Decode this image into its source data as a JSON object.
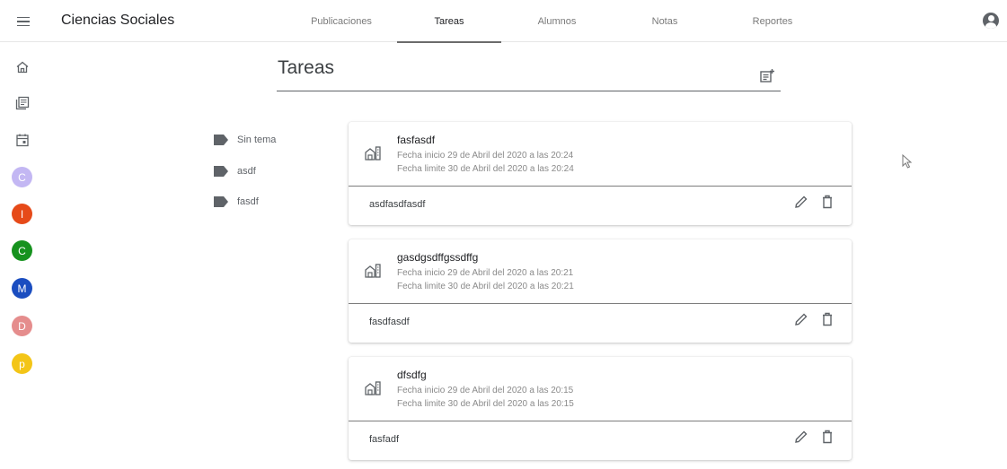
{
  "header": {
    "title": "Ciencias Sociales",
    "tabs": [
      {
        "label": "Publicaciones",
        "active": false
      },
      {
        "label": "Tareas",
        "active": true
      },
      {
        "label": "Alumnos",
        "active": false
      },
      {
        "label": "Notas",
        "active": false
      },
      {
        "label": "Reportes",
        "active": false
      }
    ],
    "account_icon": "account-circle-icon"
  },
  "rail": {
    "icons": [
      "home-icon",
      "class-list-icon",
      "calendar-icon"
    ],
    "avatars": [
      {
        "letter": "C",
        "color": "#c3b7f3"
      },
      {
        "letter": "I",
        "color": "#e64a19"
      },
      {
        "letter": "C",
        "color": "#16921e"
      },
      {
        "letter": "M",
        "color": "#1a4dc0"
      },
      {
        "letter": "D",
        "color": "#e58d8d"
      },
      {
        "letter": "p",
        "color": "#f3c517"
      }
    ]
  },
  "page": {
    "title": "Tareas",
    "add_icon": "post-add-icon"
  },
  "topics": [
    {
      "label": "Sin tema"
    },
    {
      "label": "asdf"
    },
    {
      "label": "fasdf"
    }
  ],
  "tasks": [
    {
      "title": "fasfasdf",
      "start": "Fecha inicio 29 de Abril del 2020 a las 20:24",
      "end": "Fecha limite 30 de Abril del 2020 a las 20:24",
      "description": "asdfasdfasdf"
    },
    {
      "title": "gasdgsdffgssdffg",
      "start": "Fecha inicio 29 de Abril del 2020 a las 20:21",
      "end": "Fecha limite 30 de Abril del 2020 a las 20:21",
      "description": "fasdfasdf"
    },
    {
      "title": "dfsdfg",
      "start": "Fecha inicio 29 de Abril del 2020 a las 20:15",
      "end": "Fecha limite 30 de Abril del 2020 a las 20:15",
      "description": "fasfadf"
    }
  ],
  "colors": {
    "accent": "#6b6b6b",
    "text_secondary": "#8a8a8a"
  }
}
